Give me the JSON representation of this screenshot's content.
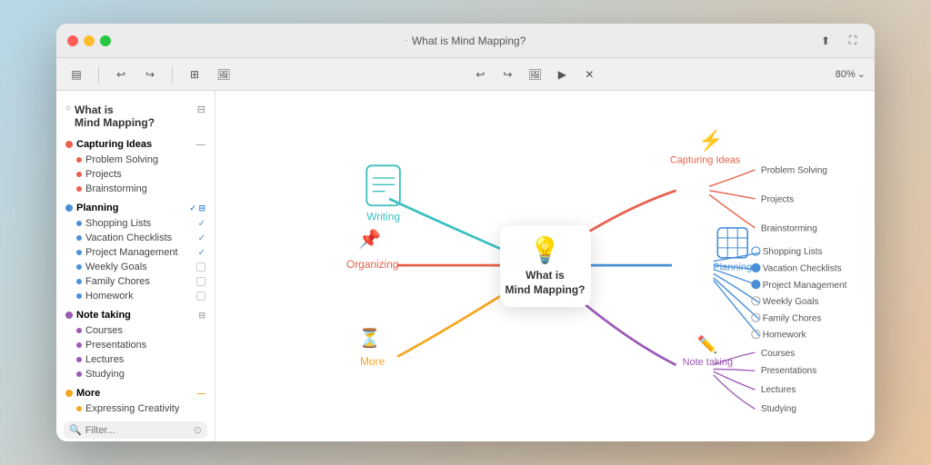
{
  "window": {
    "title": "What is Mind Mapping?",
    "title_dot": "·",
    "zoom": "80%"
  },
  "toolbar": {
    "undo_label": "↩",
    "redo_label": "↪",
    "insert_label": "⊞",
    "share_label": "⬆",
    "fullscreen_label": "⛶",
    "close_label": "✕",
    "sidebar_label": "▤",
    "grid_label": "⊟",
    "zoom_in_label": "+",
    "zoom_out_label": "−",
    "chevron_down": "⌄",
    "undo2": "↩",
    "redo2": "↪",
    "image_icon": "🖼",
    "play_icon": "▶"
  },
  "sidebar": {
    "title_line1": "What is",
    "title_line2": "Mind Mapping?",
    "sections": [
      {
        "id": "capturing",
        "label": "Capturing Ideas",
        "color": "#e8604c",
        "items": [
          {
            "text": "Problem Solving",
            "check": null
          },
          {
            "text": "Projects",
            "check": null
          },
          {
            "text": "Brainstorming",
            "check": null
          }
        ]
      },
      {
        "id": "planning",
        "label": "Planning",
        "color": "#4a90d9",
        "items": [
          {
            "text": "Shopping Lists",
            "check": "✓"
          },
          {
            "text": "Vacation Checklists",
            "check": "✓"
          },
          {
            "text": "Project Management",
            "check": "✓"
          },
          {
            "text": "Weekly Goals",
            "check": "box"
          },
          {
            "text": "Family Chores",
            "check": "box"
          },
          {
            "text": "Homework",
            "check": "box"
          }
        ]
      },
      {
        "id": "notetaking",
        "label": "Note taking",
        "color": "#9b59b6",
        "items": [
          {
            "text": "Courses",
            "check": null
          },
          {
            "text": "Presentations",
            "check": null
          },
          {
            "text": "Lectures",
            "check": null
          },
          {
            "text": "Studying",
            "check": null
          }
        ]
      },
      {
        "id": "more",
        "label": "More",
        "color": "#f5a623",
        "items": [
          {
            "text": "Expressing Creativity",
            "check": null
          }
        ]
      }
    ],
    "search_placeholder": "Filter..."
  },
  "mindmap": {
    "central": {
      "text": "What is\nMind Mapping?",
      "icon": "💡"
    },
    "branches": [
      {
        "id": "writing",
        "label": "Writing",
        "icon": "📓",
        "color": "#3dbfbf",
        "direction": "left",
        "items": []
      },
      {
        "id": "capturing",
        "label": "Capturing Ideas",
        "icon": "⚡",
        "color": "#e8604c",
        "direction": "right",
        "items": [
          "Problem Solving",
          "Projects",
          "Brainstorming"
        ]
      },
      {
        "id": "organizing",
        "label": "Organizing",
        "icon": "📌",
        "color": "#e8604c",
        "direction": "left",
        "items": []
      },
      {
        "id": "planning",
        "label": "Planning",
        "icon": "📋",
        "color": "#4a90d9",
        "direction": "right",
        "items": [
          "Shopping Lists",
          "Vacation Checklists",
          "Project Management",
          "Weekly Goals",
          "Family Chores",
          "Homework"
        ]
      },
      {
        "id": "more",
        "label": "More",
        "icon": "⏳",
        "color": "#f5a623",
        "direction": "left",
        "items": []
      },
      {
        "id": "notetaking",
        "label": "Note taking",
        "icon": "✏️",
        "color": "#9b59b6",
        "direction": "right",
        "items": [
          "Courses",
          "Presentations",
          "Lectures",
          "Studying"
        ]
      }
    ]
  }
}
